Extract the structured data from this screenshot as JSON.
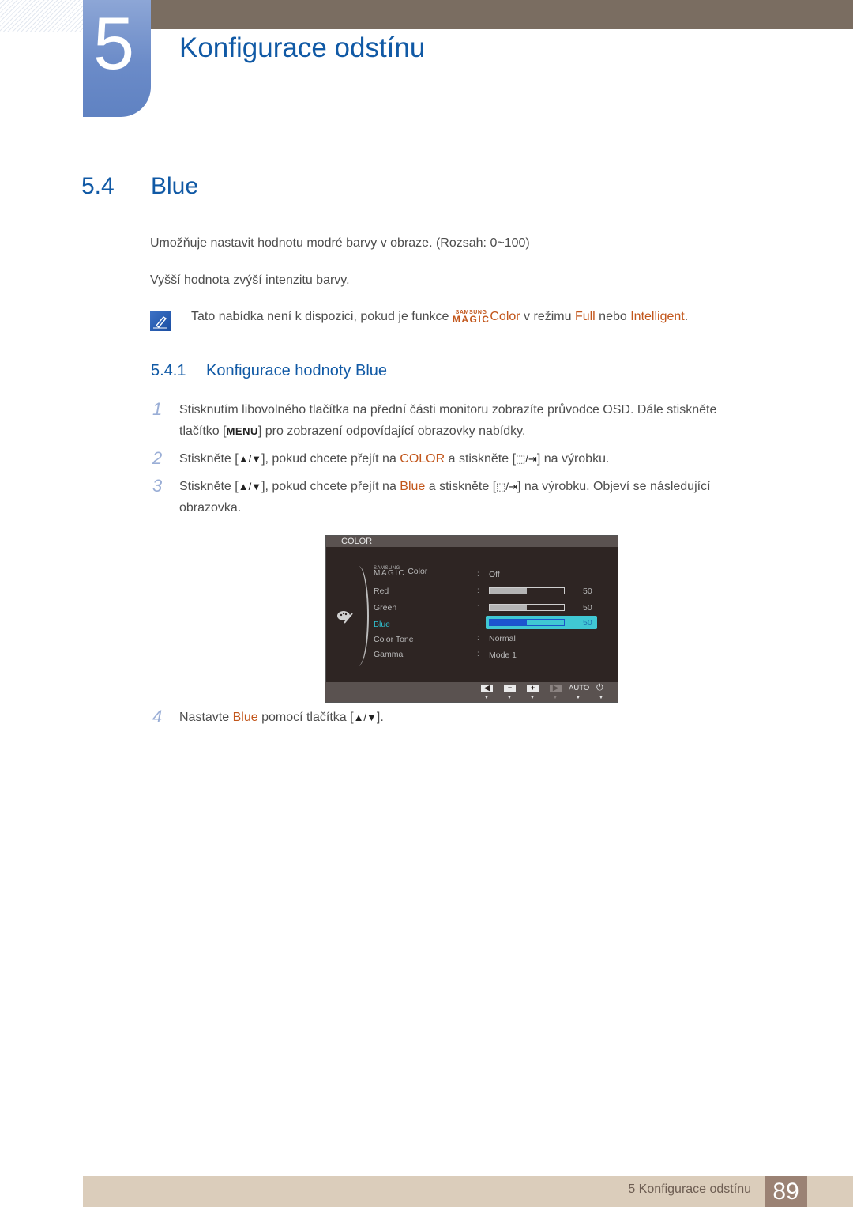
{
  "header": {
    "chapter_number": "5",
    "chapter_title": "Konfigurace odstínu"
  },
  "section": {
    "number": "5.4",
    "title": "Blue"
  },
  "intro": {
    "para1": "Umožňuje nastavit hodnotu modré barvy v obraze. (Rozsah: 0~100)",
    "para2": "Vyšší hodnota zvýší intenzitu barvy."
  },
  "note": {
    "icon": "note-pencil-icon",
    "text_before": "Tato nabídka není k dispozici, pokud je funkce ",
    "magic_top": "SAMSUNG",
    "magic_bottom": "MAGIC",
    "magic_suffix": "Color",
    "text_middle": " v režimu ",
    "full": "Full",
    "text_or": " nebo ",
    "intelligent": "Intelligent",
    "text_end": "."
  },
  "subsection": {
    "number": "5.4.1",
    "title": "Konfigurace hodnoty Blue"
  },
  "steps": [
    {
      "num": "1",
      "line1": "Stisknutím libovolného tlačítka na přední části monitoru zobrazíte průvodce OSD. Dále stiskněte",
      "line2_before": "tlačítko [",
      "key": "MENU",
      "line2_after": "] pro zobrazení odpovídající obrazovky nabídky."
    },
    {
      "num": "2",
      "before": "Stiskněte [",
      "updown": "▲/▼",
      "middle": "], pokud chcete přejít na ",
      "target": "COLOR",
      "after": " a stiskněte [",
      "enter": "⬚/⇥",
      "end": "] na výrobku."
    },
    {
      "num": "3",
      "before": "Stiskněte [",
      "updown": "▲/▼",
      "middle": "], pokud chcete přejít na ",
      "target": "Blue",
      "after": " a stiskněte [",
      "enter": "⬚/⇥",
      "end": "] na výrobku. Objeví se následující",
      "line2": "obrazovka."
    },
    {
      "num": "4",
      "before": "Nastavte ",
      "target": "Blue",
      "middle": " pomocí tlačítka [",
      "updown": "▲/▼",
      "end": "]."
    }
  ],
  "osd": {
    "header": "COLOR",
    "menu_icon": "palette-icon",
    "items": [
      {
        "label_top": "SAMSUNG",
        "label_bottom": "MAGIC",
        "label_suffix": "Color",
        "value": "Off"
      },
      {
        "label": "Red",
        "level": 50,
        "value": "50"
      },
      {
        "label": "Green",
        "level": 50,
        "value": "50"
      },
      {
        "label": "Blue",
        "level": 50,
        "value": "50",
        "selected": true
      },
      {
        "label": "Color Tone",
        "value": "Normal"
      },
      {
        "label": "Gamma",
        "value": "Mode 1"
      }
    ],
    "colon": ":",
    "footer": {
      "buttons": [
        "◀",
        "−",
        "+",
        "▶"
      ],
      "auto": "AUTO",
      "power": "⏻",
      "arrow": "▼"
    },
    "colors": {
      "background": "#2e2523",
      "highlight": "#40c8d4",
      "selected_text": "#2fc4d4"
    }
  },
  "footer": {
    "chapter_ref": "5 Konfigurace odstínu",
    "page_number": "89"
  },
  "colors": {
    "heading": "#1059a5",
    "highlight": "#c2561b",
    "top_bar": "#7a6d61",
    "footer_bar": "#dbcdbb",
    "page_box": "#9b8274"
  }
}
